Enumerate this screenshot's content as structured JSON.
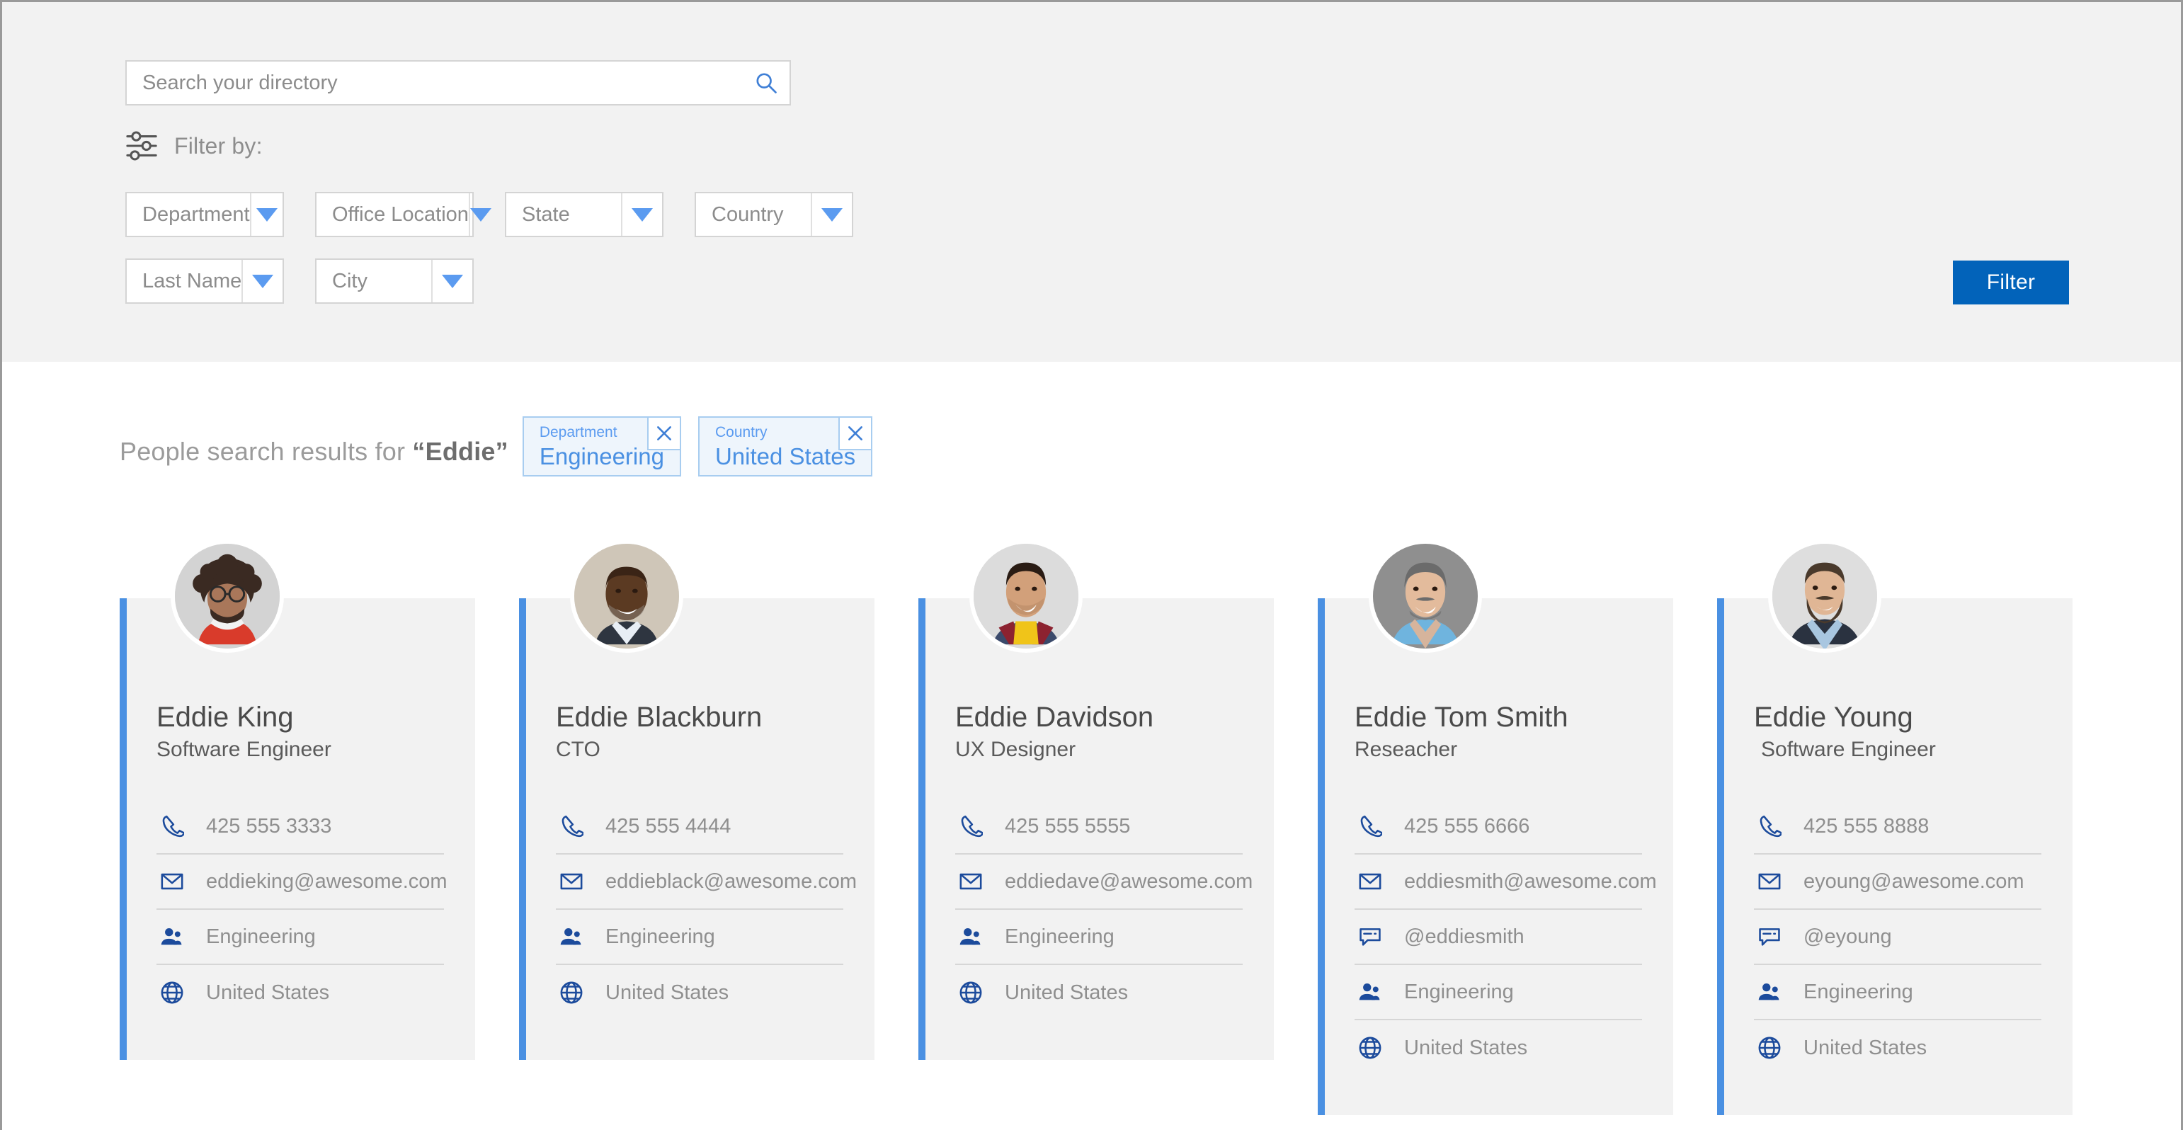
{
  "search": {
    "placeholder": "Search your directory",
    "value": "",
    "icon": "search-icon"
  },
  "filter_by": {
    "label": "Filter by:",
    "icon": "sliders-icon"
  },
  "dropdowns": {
    "row1": [
      {
        "label": "Department"
      },
      {
        "label": "Office Location"
      },
      {
        "label": "State"
      },
      {
        "label": "Country"
      }
    ],
    "row2": [
      {
        "label": "Last Name"
      },
      {
        "label": "City"
      }
    ]
  },
  "filter_button": {
    "label": "Filter"
  },
  "results": {
    "title_prefix": "People search results for ",
    "query": "“Eddie”",
    "chips": [
      {
        "label": "Department",
        "value": "Engineering",
        "close": "✕"
      },
      {
        "label": "Country",
        "value": "United States",
        "close": "✕"
      }
    ]
  },
  "colors": {
    "accent_blue": "#4a90e2",
    "button_blue": "#0263ba",
    "icon_blue": "#1c4b9c",
    "panel_gray": "#f2f2f2",
    "card_gray": "#f2f2f2",
    "text_gray": "#8f8f8f"
  },
  "cards": [
    {
      "name": "Eddie King",
      "title": "Software Engineer",
      "avatar": "avatar-eddie-king",
      "rows": [
        {
          "icon": "phone-icon",
          "text": "425 555 3333"
        },
        {
          "icon": "email-icon",
          "text": "eddieking@awesome.com"
        },
        {
          "icon": "department-icon",
          "text": "Engineering"
        },
        {
          "icon": "globe-icon",
          "text": "United States"
        }
      ]
    },
    {
      "name": "Eddie Blackburn",
      "title": "CTO",
      "avatar": "avatar-eddie-blackburn",
      "rows": [
        {
          "icon": "phone-icon",
          "text": "425 555 4444"
        },
        {
          "icon": "email-icon",
          "text": "eddieblack@awesome.com"
        },
        {
          "icon": "department-icon",
          "text": "Engineering"
        },
        {
          "icon": "globe-icon",
          "text": "United States"
        }
      ]
    },
    {
      "name": "Eddie Davidson",
      "title": "UX Designer",
      "avatar": "avatar-eddie-davidson",
      "rows": [
        {
          "icon": "phone-icon",
          "text": "425 555 5555"
        },
        {
          "icon": "email-icon",
          "text": "eddiedave@awesome.com"
        },
        {
          "icon": "department-icon",
          "text": "Engineering"
        },
        {
          "icon": "globe-icon",
          "text": "United States"
        }
      ]
    },
    {
      "name": "Eddie Tom Smith",
      "title": "Reseacher",
      "avatar": "avatar-eddie-tom-smith",
      "rows": [
        {
          "icon": "phone-icon",
          "text": "425 555 6666"
        },
        {
          "icon": "email-icon",
          "text": "eddiesmith@awesome.com"
        },
        {
          "icon": "chat-icon",
          "text": "@eddiesmith"
        },
        {
          "icon": "department-icon",
          "text": "Engineering"
        },
        {
          "icon": "globe-icon",
          "text": "United States"
        }
      ]
    },
    {
      "name": "Eddie Young",
      "title": "Software Engineer",
      "avatar": "avatar-eddie-young",
      "rows": [
        {
          "icon": "phone-icon",
          "text": "425 555 8888"
        },
        {
          "icon": "email-icon",
          "text": "eyoung@awesome.com"
        },
        {
          "icon": "chat-icon",
          "text": "@eyoung"
        },
        {
          "icon": "department-icon",
          "text": "Engineering"
        },
        {
          "icon": "globe-icon",
          "text": "United States"
        }
      ]
    }
  ]
}
